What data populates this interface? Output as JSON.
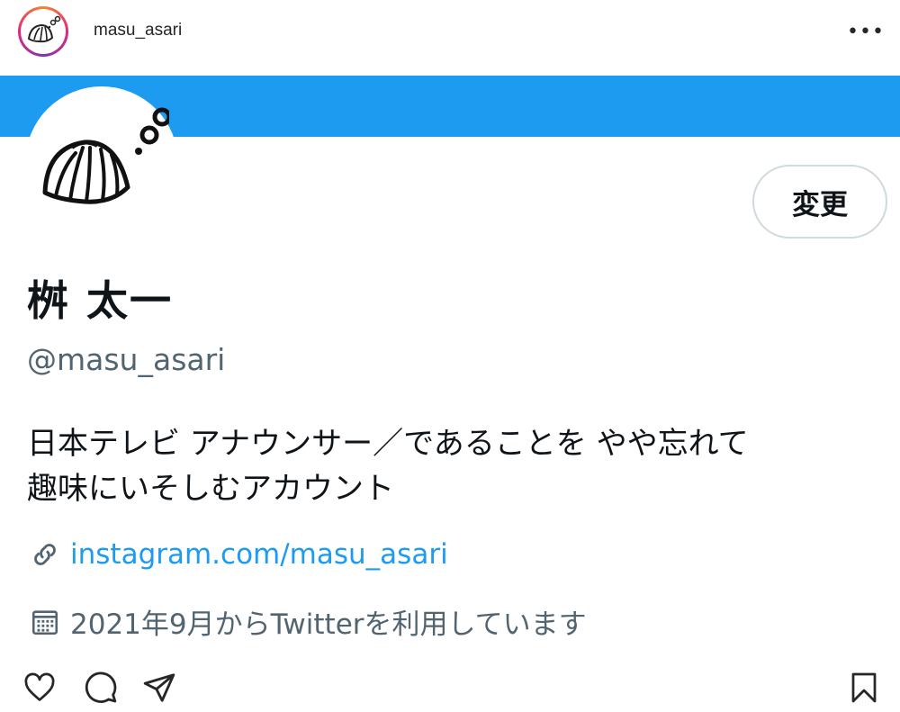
{
  "instagram": {
    "username": "masu_asari",
    "more_label": "•••"
  },
  "profile": {
    "edit_button_label": "変更",
    "display_name": "桝 太一",
    "handle": "@masu_asari",
    "bio_line1": "日本テレビ アナウンサー／であることを やや忘れて",
    "bio_line2": "趣味にいそしむアカウント",
    "link": "instagram.com/masu_asari",
    "joined": "2021年9月からTwitterを利用しています"
  },
  "colors": {
    "banner": "#1d9bf0",
    "link": "#1d9bf0",
    "secondary_text": "#536471"
  },
  "icons": {
    "avatar": "clam-shell-icon",
    "link": "link-icon",
    "calendar": "calendar-icon",
    "like": "heart-icon",
    "comment": "comment-icon",
    "share": "send-icon",
    "save": "bookmark-icon"
  }
}
